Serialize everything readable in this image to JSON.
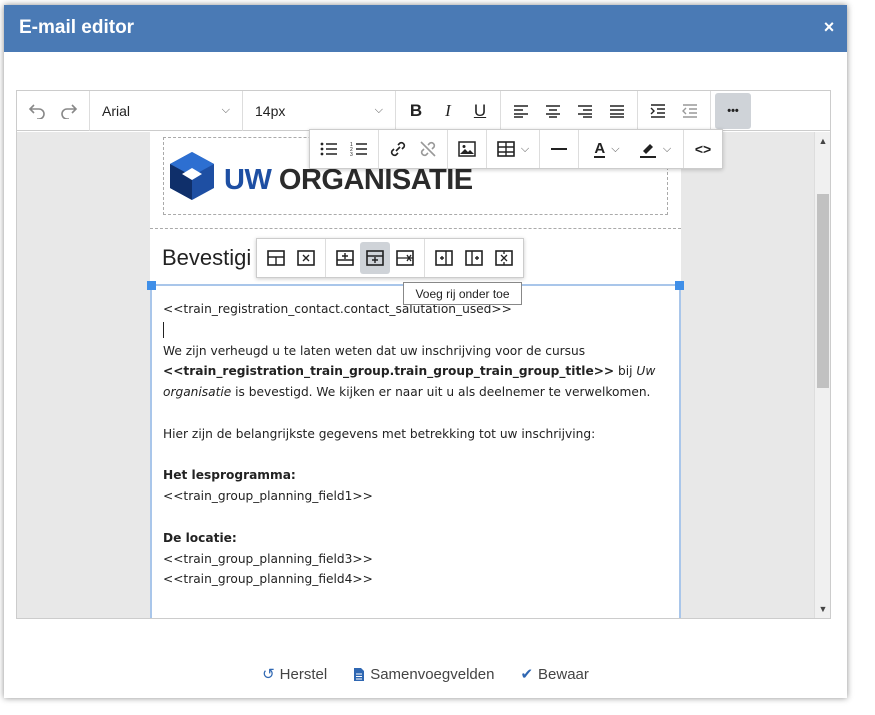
{
  "window": {
    "title": "E-mail editor",
    "close_glyph": "×"
  },
  "toolbar": {
    "undo_icon": "↶",
    "redo_icon": "↷",
    "font_family": "Arial",
    "font_size": "14px",
    "bold": "B",
    "italic": "I",
    "underline": "U",
    "more_icon": "•••"
  },
  "float_toolbar": {
    "link_icon": "link-icon",
    "unlink_icon": "unlink-icon",
    "image_icon": "image-icon",
    "table_icon": "table-icon",
    "hr_icon": "horizontal-rule-icon",
    "text_color_letter": "A",
    "code_glyph": "<>"
  },
  "table_toolbar": {
    "tooltip": "Voeg rij onder toe"
  },
  "content": {
    "logo_uw": "UW",
    "logo_org": "ORGANISATIE",
    "heading_partial": "Bevestigi",
    "lines": {
      "salutation": "<<train_registration_contact.contact_salutation_used>>",
      "p1_a": "We zijn verheugd u te laten weten dat uw inschrijving voor de cursus",
      "p1_b_bold": "<<train_registration_train_group.train_group_train_group_title>>",
      "p1_b_rest": " bij ",
      "p1_b_italic": "Uw",
      "p1_c_italic": "organisatie",
      "p1_c_rest": " is bevestigd. We kijken er naar uit u als deelnemer te verwelkomen.",
      "p2": "Hier zijn de belangrijkste gegevens met betrekking tot uw inschrijving:",
      "lesprog_label": "Het lesprogramma:",
      "lesprog_field": "<<train_group_planning_field1>>",
      "locatie_label": "De locatie:",
      "locatie_field1": "<<train_group_planning_field3>>",
      "locatie_field2": "<<train_group_planning_field4>>"
    }
  },
  "footer": {
    "reset_label": "Herstel",
    "merge_label": "Samenvoegvelden",
    "save_label": "Bewaar"
  },
  "colors": {
    "titlebar": "#4a7ab5",
    "accent": "#2f67b2",
    "selection": "#3f8fe8"
  }
}
